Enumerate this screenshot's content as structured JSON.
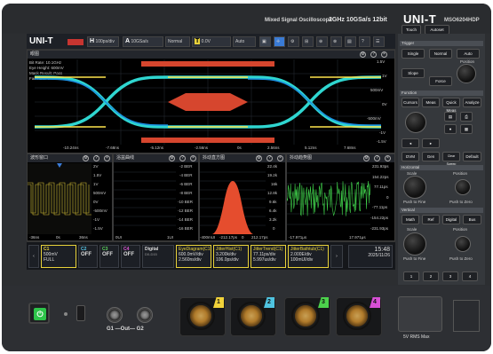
{
  "device": {
    "product_name": "Mixed Signal Oscilloscope",
    "spec": "2GHz 10GSa/s 12bit",
    "brand": "UNI-T",
    "model": "MSO6204HDP"
  },
  "topbar": {
    "logo": "UNI-T",
    "trig_h_letter": "H",
    "h_value": "100ps/div",
    "acq_letter": "A",
    "acq_line1": "10GSa/s",
    "acq_line2": "20Mpts",
    "mode": "Normal",
    "trig_letter": "T",
    "trig_level": "0.0V",
    "auto_label": "Auto",
    "auto_value": "0V",
    "icons": [
      "autoset-icon",
      "cursor-icon",
      "measure-icon",
      "grid-icon"
    ]
  },
  "eye_window": {
    "title": "眼图",
    "info_lines": [
      "Bit Rate: 10.1GHz",
      "Eye Height: 600mV",
      "Mask Result: Pass",
      "Fail Rate: 0.00%"
    ],
    "x_ticks": [
      "-10.24ns",
      "-7.68ns",
      "-5.12ns",
      "-2.56ns",
      "0s",
      "2.56ns",
      "5.12ns",
      "7.68ns",
      "10.24ns"
    ],
    "y_ticks": [
      "1.5V",
      "1V",
      "500mV",
      "0V",
      "-500mV",
      "-1V",
      "-1.5V"
    ]
  },
  "wave_window": {
    "title": "波形窗口",
    "y_ticks": [
      "2V",
      "1.5V",
      "1V",
      "500mV",
      "0V",
      "-500mV",
      "-1V",
      "-1.5V"
    ],
    "x_ticks": [
      "-36ns",
      "0s",
      "36ns"
    ]
  },
  "bathtub_window": {
    "title": "浴盆曲线",
    "y_ticks": [
      "-2 BER",
      "-4 BER",
      "-6 BER",
      "-8 BER",
      "-10 BER",
      "-12 BER",
      "-14 BER",
      "-16 BER"
    ],
    "x_ticks": [
      "0UI",
      "1UI"
    ]
  },
  "histogram_window": {
    "title": "抖动直方图",
    "y_ticks": [
      "22.4k",
      "19.2k",
      "16k",
      "12.8k",
      "9.6k",
      "6.4k",
      "3.2k",
      "0"
    ],
    "x_ticks": [
      "-400mUI",
      "-212.17ps",
      "0",
      "212.17ps"
    ]
  },
  "trend_window": {
    "title": "抖动趋势图",
    "y_ticks": [
      "231.93ps",
      "154.22ps",
      "77.11ps",
      "0",
      "-77.11ps",
      "-154.22ps",
      "-231.93ps"
    ],
    "x_ticks": [
      "-17.971μs",
      "17.971μs"
    ]
  },
  "channels": [
    {
      "name": "C1",
      "lines": [
        "500mV",
        "FULL",
        "50Ω"
      ],
      "color": "#e8d23a",
      "state": ""
    },
    {
      "name": "C2",
      "lines": [],
      "color": "#58c8e8",
      "state": "OFF"
    },
    {
      "name": "C3",
      "lines": [],
      "color": "#5dd45d",
      "state": "OFF"
    },
    {
      "name": "C4",
      "lines": [],
      "color": "#e058d8",
      "state": "OFF"
    },
    {
      "name": "Digital",
      "lines": [
        "D0-D15"
      ],
      "color": "#aaaaaa",
      "state": ""
    }
  ],
  "measures": [
    {
      "title": "EyeDiagram(C1)",
      "l1": "600.0mV/div",
      "l2": "2.560ns/div"
    },
    {
      "title": "JitterHist(C1)",
      "l1": "3.200k/div",
      "l2": "106.0ps/div"
    },
    {
      "title": "JitterTrend(C1)",
      "l1": "77.11ps/div",
      "l2": "5.997us/div"
    },
    {
      "title": "JitterBathtub(C1)",
      "l1": "2.000E/div",
      "l2": "100mUI/div"
    }
  ],
  "clock": {
    "time": "15:48",
    "date": "2025/11/26"
  },
  "panel": {
    "top_buttons": [
      "Touch",
      "Autoset"
    ],
    "trigger": {
      "title": "Trigger",
      "buttons": [
        "Single",
        "Normal",
        "Auto",
        "Slope",
        "Force"
      ],
      "knob_label": "Position"
    },
    "function": {
      "title": "Function",
      "buttons": [
        "Cursors",
        "Meas",
        "Quick Meas",
        "Analyze"
      ],
      "lower_buttons": [
        "DVM",
        "Gen",
        "Clear Sweep",
        "Default"
      ]
    },
    "horizontal": {
      "title": "Horizontal",
      "knob1": "Scale",
      "knob1_sub": "Push to Fine",
      "knob2": "Position",
      "knob2_sub": "Push to Zero"
    },
    "vertical": {
      "title": "Vertical",
      "buttons": [
        "Math",
        "Ref",
        "Digital",
        "Bus"
      ],
      "knob1": "Scale",
      "knob1_sub": "Push to Fine",
      "knob2": "Position",
      "knob2_sub": "Push to Zero",
      "channel_buttons": [
        "1",
        "2",
        "3",
        "4"
      ]
    }
  },
  "front": {
    "out_label": "G1 —Out— G2",
    "rms_label": "5V RMS Max",
    "ch_badges": [
      "1",
      "2",
      "3",
      "4"
    ],
    "ch_colors": [
      "#f1d23a",
      "#4fc3e0",
      "#4cd24c",
      "#d64fd4"
    ]
  }
}
